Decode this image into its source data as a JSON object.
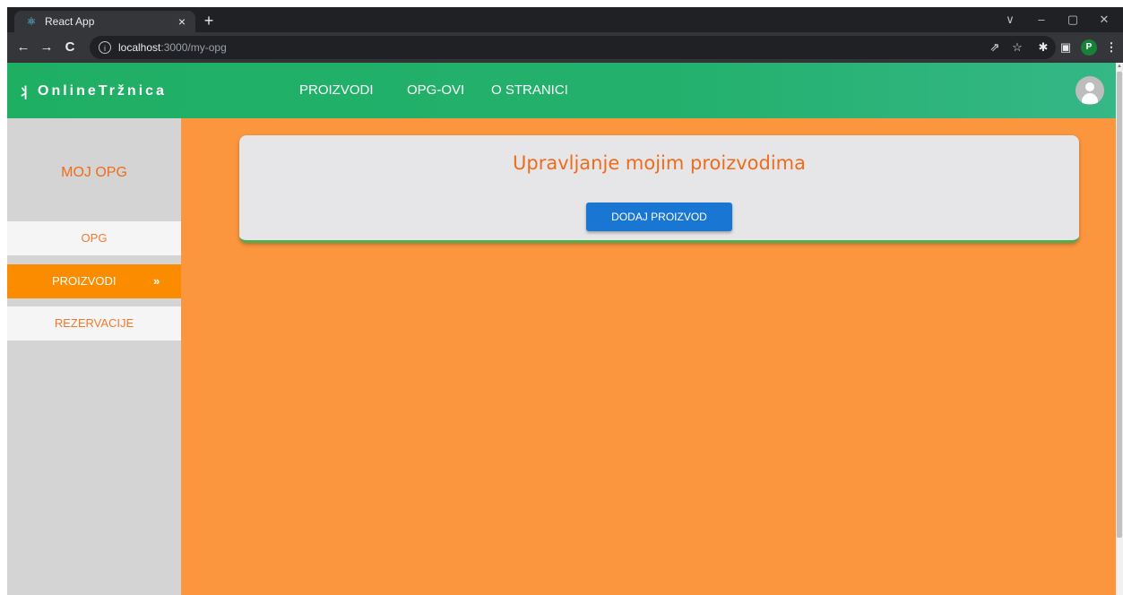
{
  "browser": {
    "tab_title": "React App",
    "tab_close": "×",
    "new_tab": "+",
    "url_host": "localhost",
    "url_path": ":3000/my-opg",
    "profile_initial": "P",
    "icons": {
      "back": "←",
      "forward": "→",
      "reload": "C",
      "info": "i",
      "share": "⇗",
      "star": "☆",
      "extensions": "✱",
      "sidepanel": "▣",
      "menu": "⋮",
      "minimize": "–",
      "maximize": "▢",
      "close": "✕",
      "tablist": "∨",
      "favicon": "⚛"
    }
  },
  "header": {
    "logo_icon": "⺦",
    "logo_text": "OnlineTržnica",
    "nav": [
      "PROIZVODI",
      "OPG-OVI",
      "O STRANICI"
    ],
    "background": "#23b06d"
  },
  "sidebar": {
    "title": "MOJ OPG",
    "items": [
      {
        "label": "OPG",
        "active": false
      },
      {
        "label": "PROIZVODI",
        "active": true,
        "indicator": "»"
      },
      {
        "label": "REZERVACIJE",
        "active": false
      }
    ],
    "accent": "#fb8c00"
  },
  "main": {
    "background": "#fb953e",
    "card_title": "Upravljanje mojim proizvodima",
    "add_button_label": "DODAJ PROIZVOD",
    "button_color": "#1976d2"
  }
}
